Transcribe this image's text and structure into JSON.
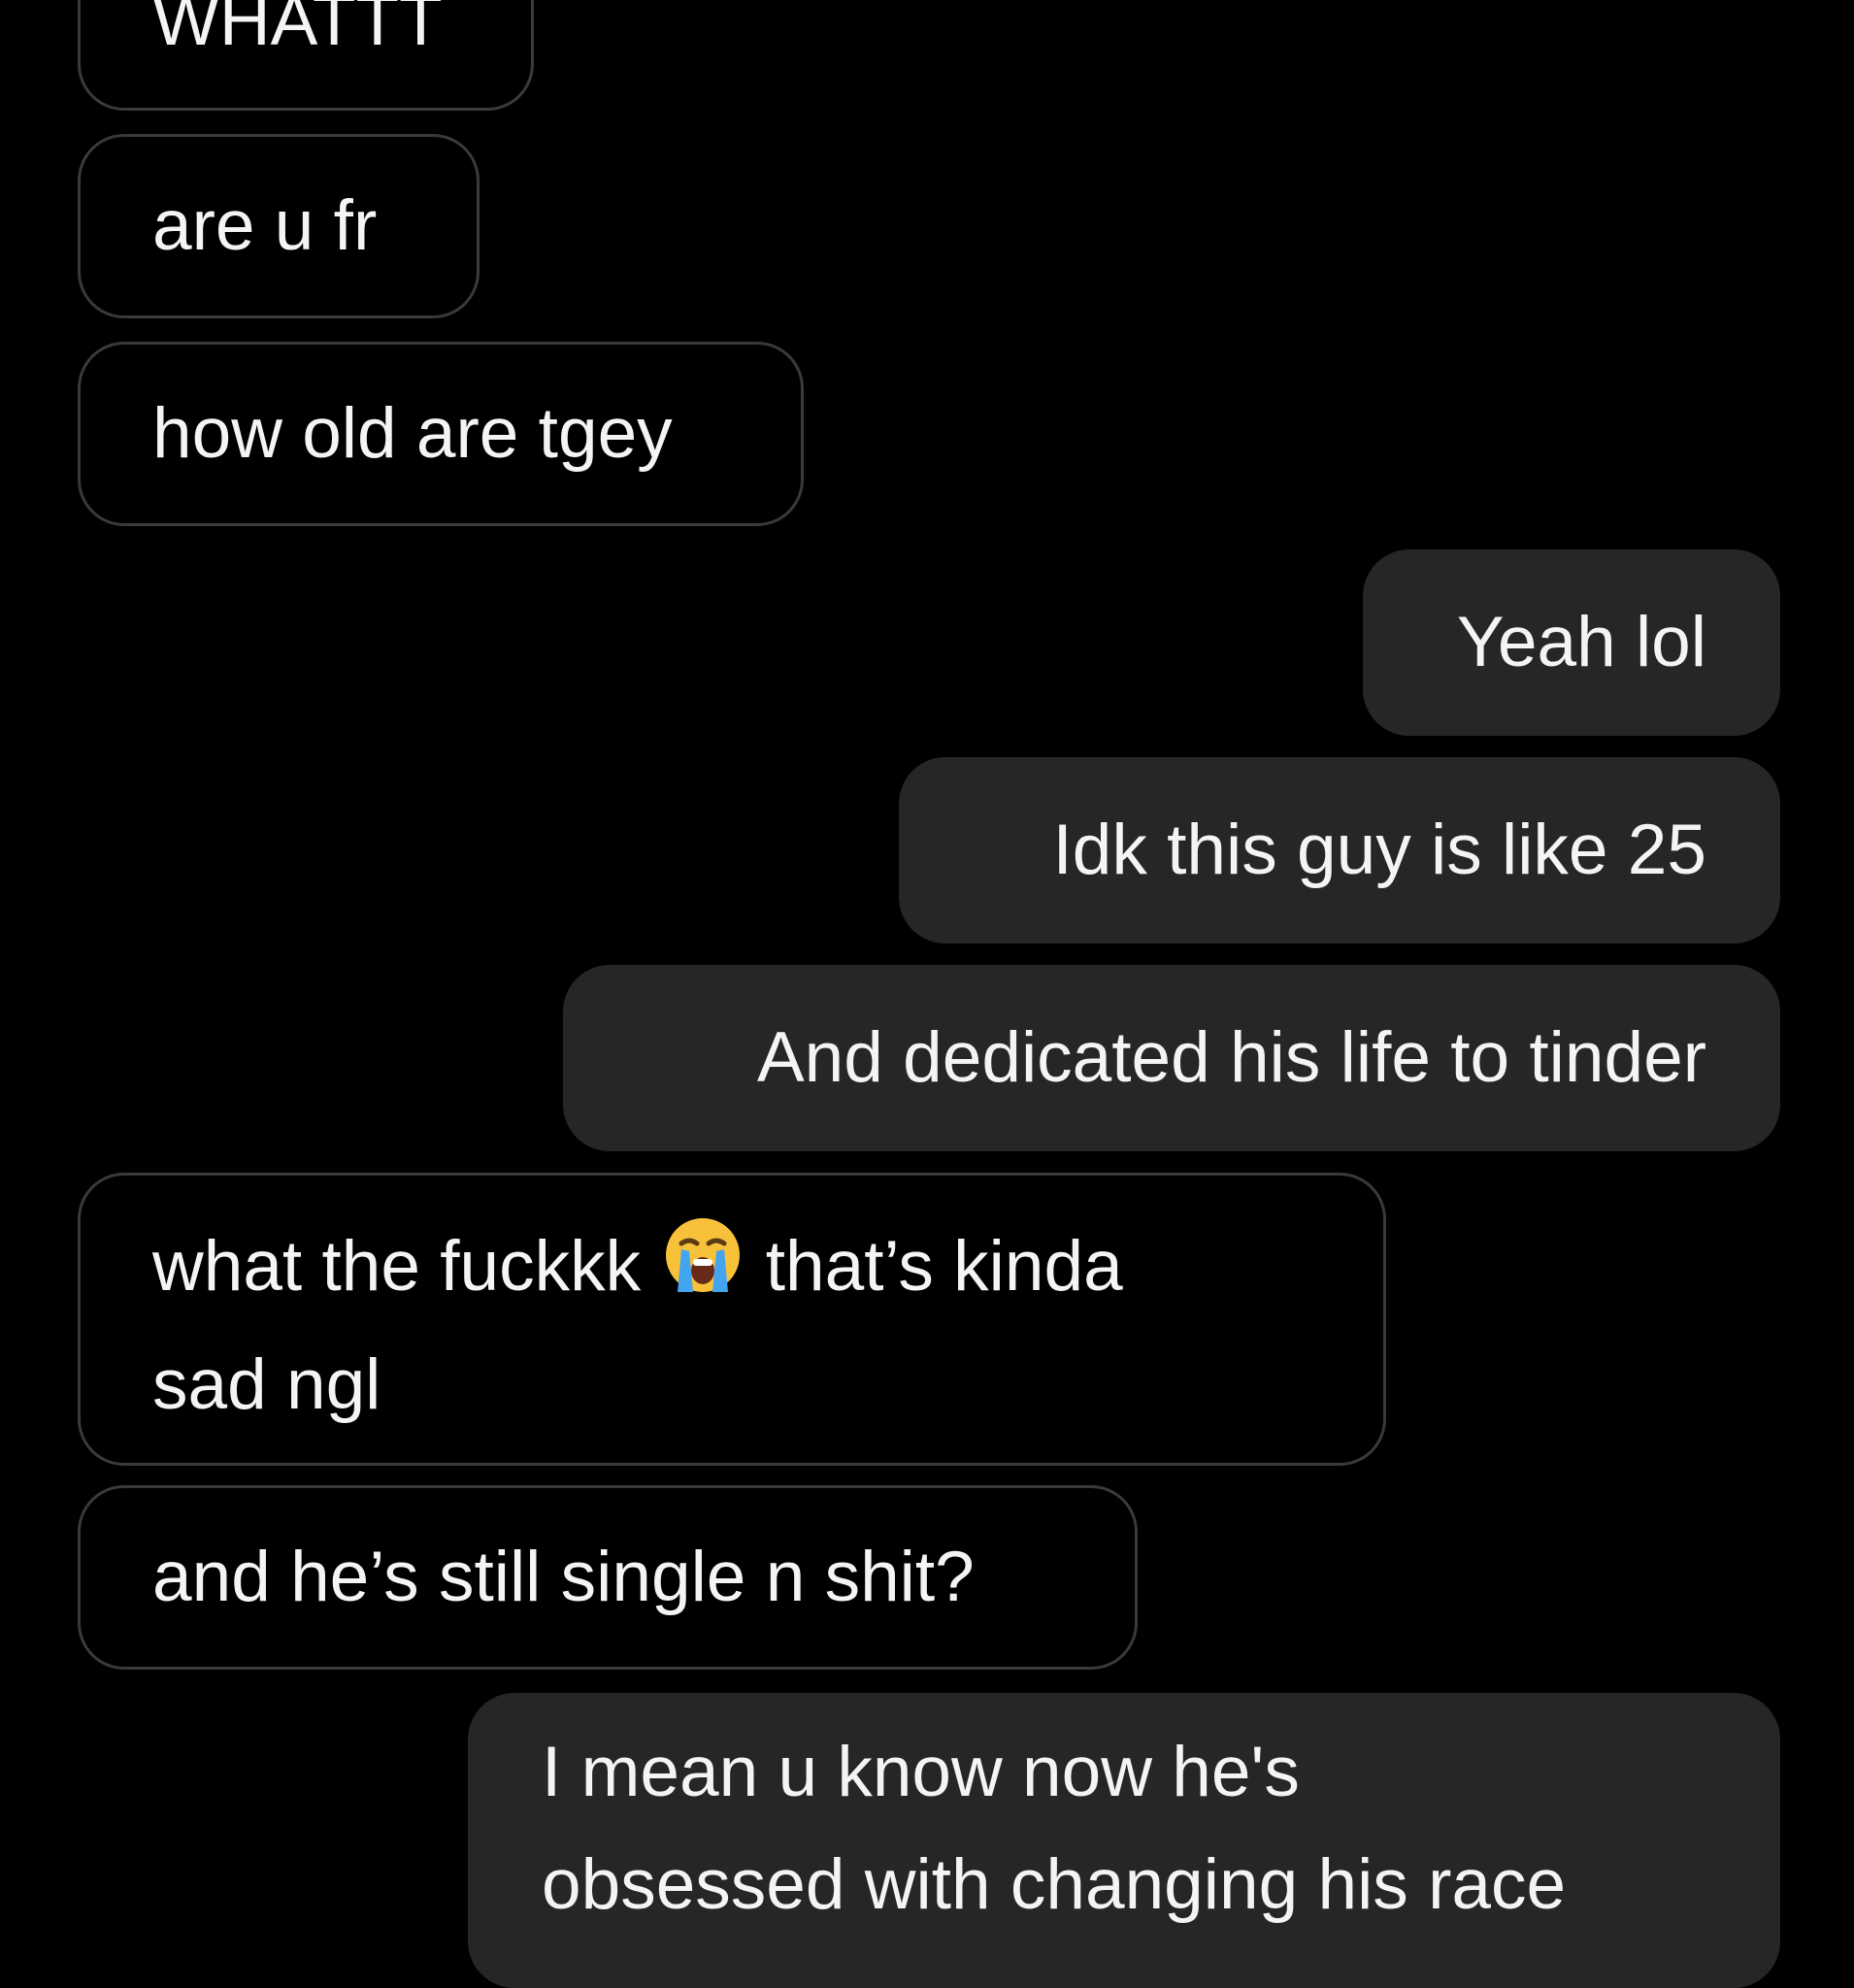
{
  "conversation": {
    "messages": [
      {
        "side": "incoming",
        "text": "WHATTT"
      },
      {
        "side": "incoming",
        "text": "are u fr"
      },
      {
        "side": "incoming",
        "text": "how old are tgey"
      },
      {
        "side": "outgoing",
        "text": "Yeah lol"
      },
      {
        "side": "outgoing",
        "text": "Idk this guy is like 25"
      },
      {
        "side": "outgoing",
        "text": "And dedicated his life to tinder"
      },
      {
        "side": "incoming",
        "text_before_emoji": "what the fuckkk",
        "emoji": "loudly-crying-face-icon",
        "text_after_emoji": "that’s kinda",
        "line2": "sad ngl"
      },
      {
        "side": "incoming",
        "text": "and he’s still single n shit?"
      },
      {
        "side": "outgoing",
        "line1": "I mean u know now he's",
        "line2": "obsessed with changing his race"
      }
    ]
  },
  "colors": {
    "background": "#000000",
    "outgoing_bubble": "#262628",
    "incoming_border": "#3a3a3a",
    "text": "#f4f4f4"
  }
}
